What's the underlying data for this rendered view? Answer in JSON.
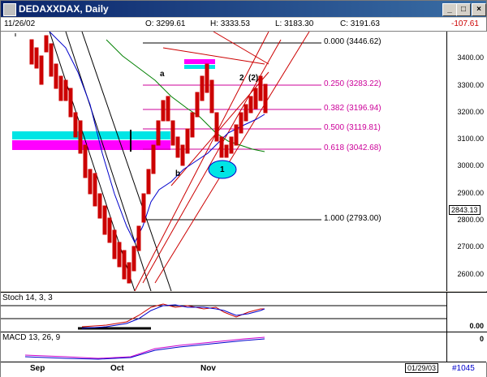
{
  "window": {
    "title": "DEDAXXDAX, Daily",
    "buttons": [
      "_",
      "□",
      "×"
    ]
  },
  "info": {
    "date": "11/26/02",
    "open": "O: 3299.61",
    "high": "H: 3333.53",
    "low": "L: 3183.30",
    "close": "C: 3191.63",
    "change": "-107.61"
  },
  "fib_levels": [
    {
      "ratio": "0.000",
      "value": "(3446.62)"
    },
    {
      "ratio": "0.250",
      "value": "(3283.22)"
    },
    {
      "ratio": "0.382",
      "value": "(3196.94)"
    },
    {
      "ratio": "0.500",
      "value": "(3119.81)"
    },
    {
      "ratio": "0.618",
      "value": "(3042.68)"
    },
    {
      "ratio": "1.000",
      "value": "(2793.00)"
    }
  ],
  "wave_labels": {
    "a": "a",
    "b": "b",
    "one": "1",
    "two": "2",
    "two_alt": "(2)"
  },
  "price_axis": [
    "3400.00",
    "3300.00",
    "3200.00",
    "3100.00",
    "3000.00",
    "2900.00",
    "2800.00",
    "2700.00",
    "2600.00"
  ],
  "price_current": "2843.13",
  "stoch": {
    "label": "Stoch 14, 3, 3",
    "value": "0.00"
  },
  "macd": {
    "label": "MACD 13, 26, 9",
    "value": "0"
  },
  "months": [
    "Sep",
    "Oct",
    "Nov"
  ],
  "footer": {
    "date": "01/29/03",
    "bar_number": "#1045"
  },
  "colors": {
    "up": "#cc0000",
    "fib": "#cc0099",
    "ma_green": "#008000",
    "ma_blue": "#0000cc",
    "cyan": "#00e5e5",
    "magenta": "#ff00ff"
  }
}
